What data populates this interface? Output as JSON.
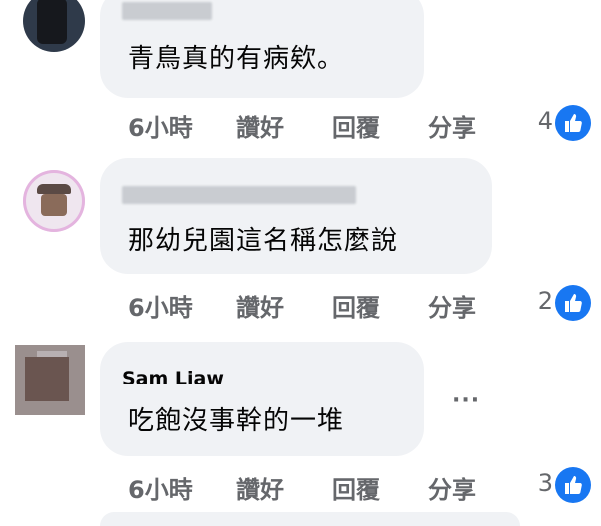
{
  "comments": [
    {
      "commenter": "",
      "text": "青鳥真的有病欸。",
      "time": "6小時",
      "like_label": "讚好",
      "reply_label": "回覆",
      "share_label": "分享",
      "reaction_count": "4",
      "reaction_icon": "thumbs-up-icon"
    },
    {
      "commenter": "",
      "text": "那幼兒園這名稱怎麼說",
      "time": "6小時",
      "like_label": "讚好",
      "reply_label": "回覆",
      "share_label": "分享",
      "reaction_count": "2",
      "reaction_icon": "thumbs-up-icon"
    },
    {
      "commenter": "Sam Liaw",
      "text": "吃飽沒事幹的一堆",
      "time": "6小時",
      "like_label": "讚好",
      "reply_label": "回覆",
      "share_label": "分享",
      "reaction_count": "3",
      "reaction_icon": "thumbs-up-icon",
      "more_label": "···"
    }
  ],
  "colors": {
    "bubble": "#f0f2f5",
    "action_text": "#65676b",
    "like_blue": "#1877f2"
  }
}
